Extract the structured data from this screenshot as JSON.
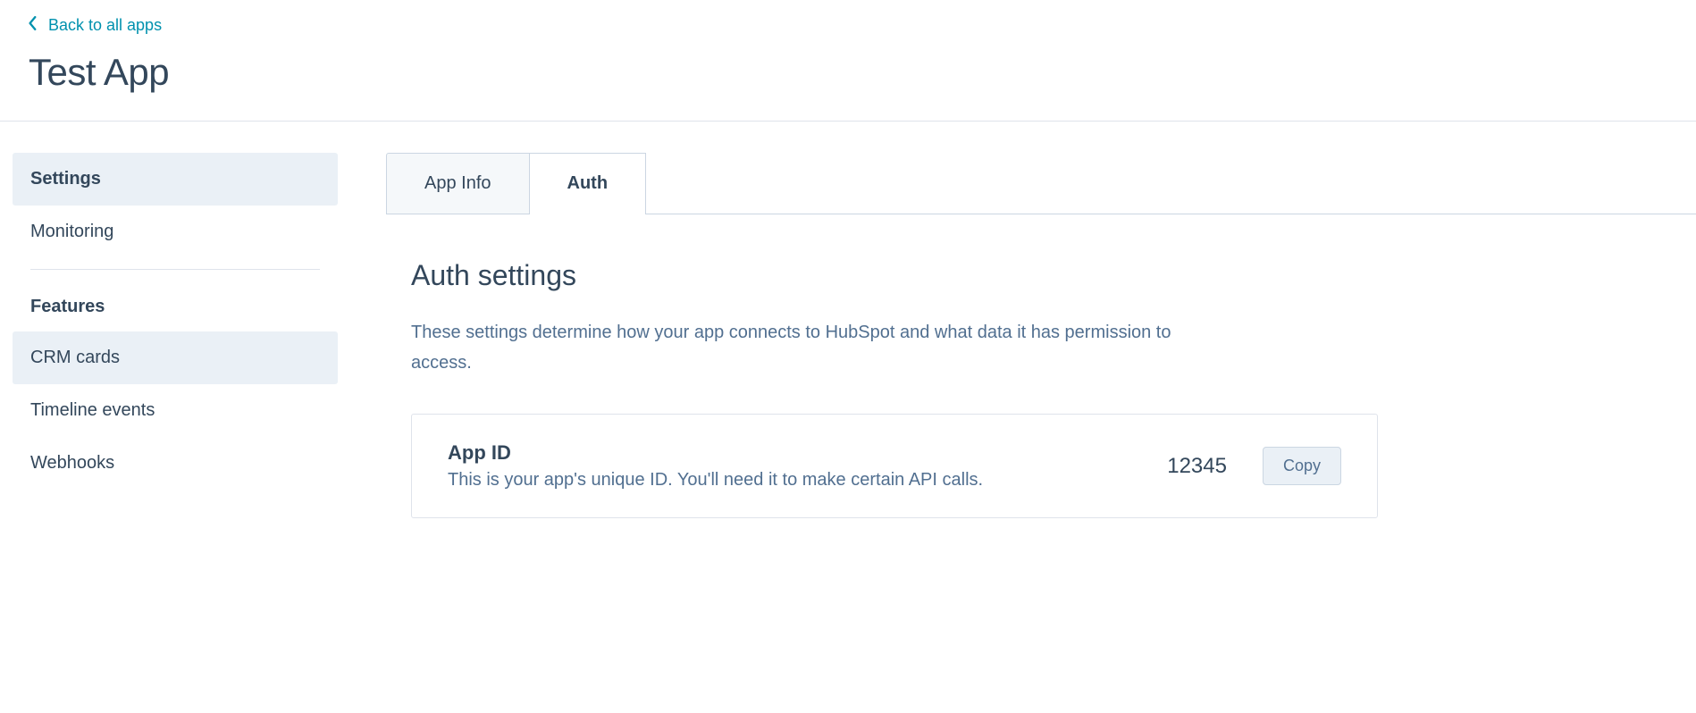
{
  "header": {
    "back_label": "Back to all apps",
    "app_title": "Test App"
  },
  "sidebar": {
    "settings_label": "Settings",
    "monitoring_label": "Monitoring",
    "features_heading": "Features",
    "crm_cards_label": "CRM cards",
    "timeline_events_label": "Timeline events",
    "webhooks_label": "Webhooks"
  },
  "tabs": {
    "app_info": "App Info",
    "auth": "Auth"
  },
  "auth_section": {
    "title": "Auth settings",
    "description": "These settings determine how your app connects to HubSpot and what data it has permission to access."
  },
  "app_id_card": {
    "title": "App ID",
    "description": "This is your app's unique ID. You'll need it to make certain API calls.",
    "value": "12345",
    "copy_label": "Copy"
  }
}
